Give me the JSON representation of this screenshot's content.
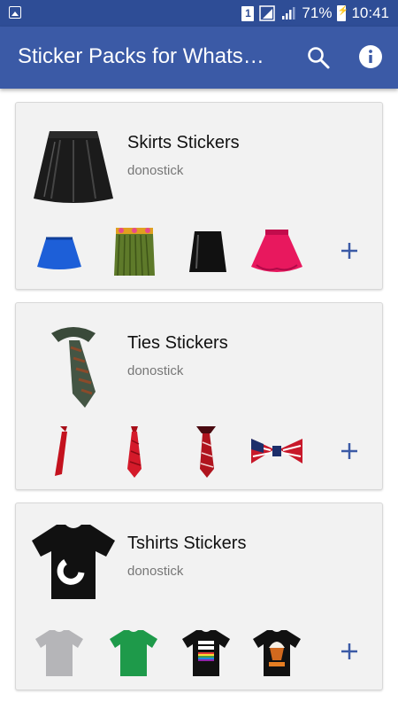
{
  "status_bar": {
    "sim_label": "1",
    "battery": "71%",
    "time": "10:41"
  },
  "app_bar": {
    "title": "Sticker Packs for Whats…",
    "search_icon": "search-icon",
    "info_icon": "info-icon"
  },
  "packs": [
    {
      "name": "Skirts Stickers",
      "author": "donostick",
      "thumbs": [
        "blue skirt",
        "grass skirt",
        "black mini skirt",
        "pink tutu"
      ]
    },
    {
      "name": "Ties Stickers",
      "author": "donostick",
      "thumbs": [
        "red tie",
        "red striped tie",
        "red diagonal tie",
        "flag bow tie"
      ]
    },
    {
      "name": "Tshirts Stickers",
      "author": "donostick",
      "thumbs": [
        "grey t-shirt",
        "green t-shirt",
        "black printed t-shirt",
        "black cupcake t-shirt"
      ]
    }
  ],
  "colors": {
    "status_bar": "#2e4d96",
    "app_bar": "#3b5aa6",
    "add_icon": "#3b5aa6"
  }
}
